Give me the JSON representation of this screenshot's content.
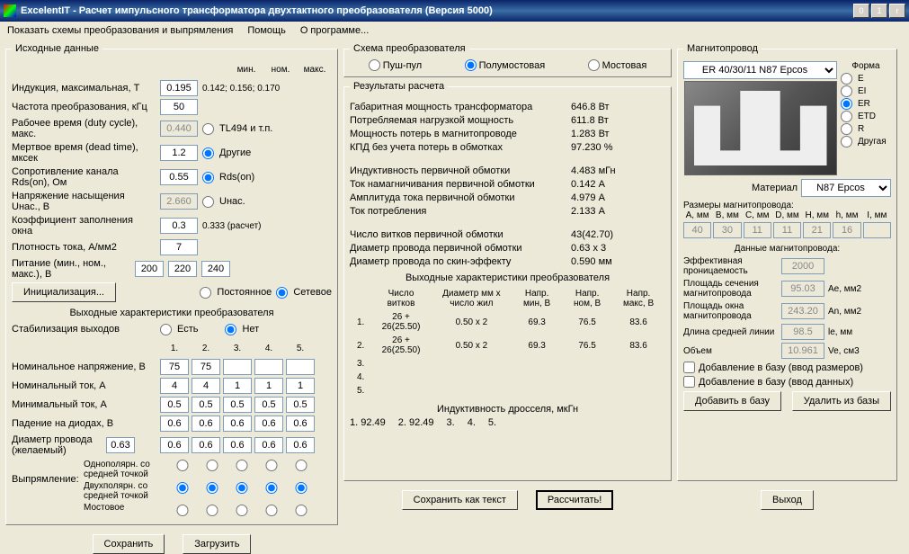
{
  "title": "ExcelentIT - Расчет импульсного трансформатора двухтактного преобразователя (Версия 5000)",
  "menubar": {
    "schemes": "Показать схемы преобразования и выпрямления",
    "help": "Помощь",
    "about": "О программе..."
  },
  "input": {
    "legend": "Исходные данные",
    "cols": {
      "min": "мин.",
      "nom": "ном.",
      "max": "макс."
    },
    "induction": {
      "label": "Индукция, максимальная, Т",
      "value": "0.195",
      "min": "0.142",
      "nom": "0.156",
      "max": "0.170"
    },
    "freq": {
      "label": "Частота преобразования, кГц",
      "value": "50"
    },
    "duty": {
      "label": "Рабочее время (duty cycle), макс.",
      "value": "0.440"
    },
    "dead": {
      "label": "Мертвое время (dead time), мксек",
      "value": "1.2"
    },
    "rds": {
      "label": "Сопротивление канала Rds(on), Ом",
      "value": "0.55"
    },
    "unas": {
      "label": "Напряжение насыщения Uнас., В",
      "value": "2.660"
    },
    "kfill": {
      "label": "Коэффициент заполнения окна",
      "value": "0.3",
      "calc": "0.333 (расчет)"
    },
    "jcur": {
      "label": "Плотность тока, А/мм2",
      "value": "7"
    },
    "supply": {
      "label": "Питание (мин., ном., макс.), В",
      "v1": "200",
      "v2": "220",
      "v3": "240"
    },
    "init_btn": "Инициализация...",
    "ctrl": {
      "tl494": "TL494 и т.п.",
      "other": "Другие"
    },
    "rds_radio": {
      "rds": "Rds(on)",
      "unas": "Uнас."
    },
    "ps": {
      "dc": "Постоянное",
      "ac": "Сетевое"
    },
    "out_legend": "Выходные характеристики преобразователя",
    "stab": {
      "label": "Стабилизация выходов",
      "yes": "Есть",
      "no": "Нет"
    },
    "channels": [
      "1.",
      "2.",
      "3.",
      "4.",
      "5."
    ],
    "vnom": {
      "label": "Номинальное напряжение, В",
      "v": [
        "75",
        "75",
        "",
        "",
        ""
      ]
    },
    "inom": {
      "label": "Номинальный ток, А",
      "v": [
        "4",
        "4",
        "1",
        "1",
        "1"
      ]
    },
    "imin": {
      "label": "Минимальный ток, А",
      "v": [
        "0.5",
        "0.5",
        "0.5",
        "0.5",
        "0.5"
      ]
    },
    "vdiode": {
      "label": "Падение на диодах, В",
      "v": [
        "0.6",
        "0.6",
        "0.6",
        "0.6",
        "0.6"
      ]
    },
    "dwire": {
      "label": "Диаметр провода (желаемый)",
      "self": "0.63",
      "v": [
        "0.6",
        "0.6",
        "0.6",
        "0.6",
        "0.6"
      ]
    },
    "rect": {
      "label": "Выпрямление:",
      "r1": "Однополярн. со средней точкой",
      "r2": "Двухполярн. со средней точкой",
      "r3": "Мостовое"
    },
    "save_btn": "Сохранить",
    "load_btn": "Загрузить"
  },
  "scheme": {
    "legend": "Схема преобразователя",
    "push": "Пуш-пул",
    "half": "Полумостовая",
    "full": "Мостовая"
  },
  "results": {
    "legend": "Результаты расчета",
    "rows": [
      {
        "label": "Габаритная мощность трансформатора",
        "val": "646.8 Вт"
      },
      {
        "label": "Потребляемая нагрузкой мощность",
        "val": "611.8 Вт"
      },
      {
        "label": "Мощность потерь в магнитопроводе",
        "val": "1.283 Вт"
      },
      {
        "label": "КПД без учета потерь в обмотках",
        "val": "97.230 %"
      }
    ],
    "rows2": [
      {
        "label": "Индуктивность первичной обмотки",
        "val": "4.483 мГн"
      },
      {
        "label": "Ток намагничивания первичной обмотки",
        "val": "0.142 А"
      },
      {
        "label": "Амплитуда тока первичной обмотки",
        "val": "4.979 А"
      },
      {
        "label": "Ток потребления",
        "val": "2.133 А"
      }
    ],
    "rows3": [
      {
        "label": "Число витков первичной обмотки",
        "val": "43(42.70)"
      },
      {
        "label": "Диаметр провода первичной обмотки",
        "val": "0.63 x 3"
      },
      {
        "label": "Диаметр провода по скин-эффекту",
        "val": "0.590 мм"
      }
    ],
    "out_hdr": "Выходные характеристики преобразователя",
    "out_th": [
      "",
      "Число витков",
      "Диаметр мм x число жил",
      "Напр. мин, В",
      "Напр. ном, В",
      "Напр. макс, В"
    ],
    "out_rows": [
      [
        "1.",
        "26 + 26(25.50)",
        "0.50 x 2",
        "69.3",
        "76.5",
        "83.6"
      ],
      [
        "2.",
        "26 + 26(25.50)",
        "0.50 x 2",
        "69.3",
        "76.5",
        "83.6"
      ],
      [
        "3.",
        "",
        "",
        "",
        "",
        ""
      ],
      [
        "4.",
        "",
        "",
        "",
        "",
        ""
      ],
      [
        "5.",
        "",
        "",
        "",
        "",
        ""
      ]
    ],
    "choke_hdr": "Индуктивность дросселя, мкГн",
    "choke_rows": [
      "1. 92.49",
      "2. 92.49",
      "3.",
      "4.",
      "5."
    ],
    "save_txt_btn": "Сохранить как текст",
    "calc_btn": "Рассчитать!"
  },
  "core": {
    "legend": "Магнитопровод",
    "selected": "ER 40/30/11 N87 Epcos",
    "shape_label": "Форма",
    "shapes": [
      "E",
      "EI",
      "ER",
      "ETD",
      "R",
      "Другая"
    ],
    "material_label": "Материал",
    "material": "N87 Epcos",
    "dims_label": "Размеры магнитопровода:",
    "dim_hdrs": [
      "A, мм",
      "B, мм",
      "C, мм",
      "D, мм",
      "H, мм",
      "h, мм",
      "I, мм"
    ],
    "dim_vals": [
      "40",
      "30",
      "11",
      "11",
      "21",
      "16",
      ""
    ],
    "data_label": "Данные магнитопровода:",
    "perm": {
      "label": "Эффективная проницаемость",
      "val": "2000",
      "unit": ""
    },
    "ae": {
      "label": "Площадь сечения магнитопровода",
      "val": "95.03",
      "unit": "Ae, мм2"
    },
    "an": {
      "label": "Площадь окна магнитопровода",
      "val": "243.20",
      "unit": "An, мм2"
    },
    "le": {
      "label": "Длина средней линии",
      "val": "98.5",
      "unit": "le, мм"
    },
    "ve": {
      "label": "Объем",
      "val": "10.961",
      "unit": "Ve, см3"
    },
    "chk1": "Добавление в базу (ввод размеров)",
    "chk2": "Добавление в базу (ввод данных)",
    "add_btn": "Добавить в базу",
    "del_btn": "Удалить из базы",
    "exit_btn": "Выход"
  }
}
